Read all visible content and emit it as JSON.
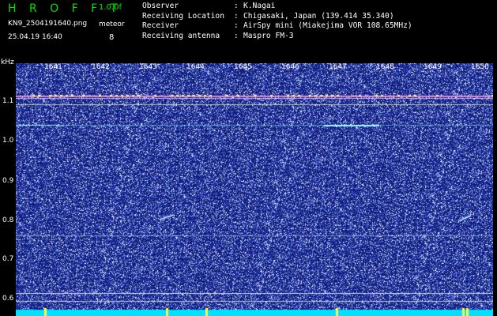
{
  "header": {
    "app_title": "H R O F F T",
    "version": "1.0.0f",
    "filename": "KN9_2504191640.png",
    "datetime": "25.04.19 16:40",
    "detection_label": "meteor",
    "detection_count": "8"
  },
  "info": [
    {
      "key": "Observer",
      "value": "K.Nagai"
    },
    {
      "key": "Receiving Location",
      "value": "Chigasaki, Japan (139.414 35.340)"
    },
    {
      "key": "Receiver",
      "value": "AirSpy mini (Miakejima VOR 108.65MHz)"
    },
    {
      "key": "Receiving antenna",
      "value": "Maspro FM-3"
    }
  ],
  "axes": {
    "y_unit": "kHz",
    "y_ticks": [
      "1.1",
      "1.0",
      "0.9",
      "0.8",
      "0.7",
      "0.6"
    ],
    "x_ticks": [
      "1641",
      "1642",
      "1643",
      "1644",
      "1645",
      "1646",
      "1647",
      "1648",
      "1649",
      "1650"
    ]
  },
  "colors": {
    "noise_background": "#1c2c9a",
    "noise_speckle": "#d8e4ff",
    "bottom_band": "#00e0ff",
    "carrier_line": "#ff8cd0",
    "header_accent": "#00e000",
    "text": "#ffffff"
  }
}
